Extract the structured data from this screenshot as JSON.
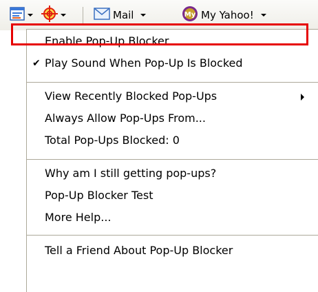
{
  "toolbar": {
    "buttons": [
      {
        "icon": "page-menu-icon",
        "has_dropdown": true
      },
      {
        "icon": "crosshair-target-icon",
        "has_dropdown": true
      },
      {
        "icon": "mail-icon",
        "label": "Mail",
        "has_dropdown": true
      },
      {
        "icon": "my-yahoo-icon",
        "icon_text": "My",
        "label": "My Yahoo!",
        "has_dropdown": true
      }
    ]
  },
  "menu": {
    "items": [
      {
        "label": "Enable Pop-Up Blocker",
        "checked": false,
        "highlighted": true
      },
      {
        "label": "Play Sound When Pop-Up Is Blocked",
        "checked": true
      },
      {
        "label": "View Recently Blocked Pop-Ups",
        "submenu": true
      },
      {
        "label": "Always Allow Pop-Ups From..."
      },
      {
        "label": "Total Pop-Ups Blocked: 0"
      },
      {
        "label": "Why am I still getting pop-ups?"
      },
      {
        "label": "Pop-Up Blocker Test"
      },
      {
        "label": "More Help..."
      },
      {
        "label": "Tell a Friend About Pop-Up Blocker"
      }
    ],
    "check_glyph": "✔"
  },
  "colors": {
    "highlight_border": "#e60000",
    "separator": "#aca899"
  }
}
